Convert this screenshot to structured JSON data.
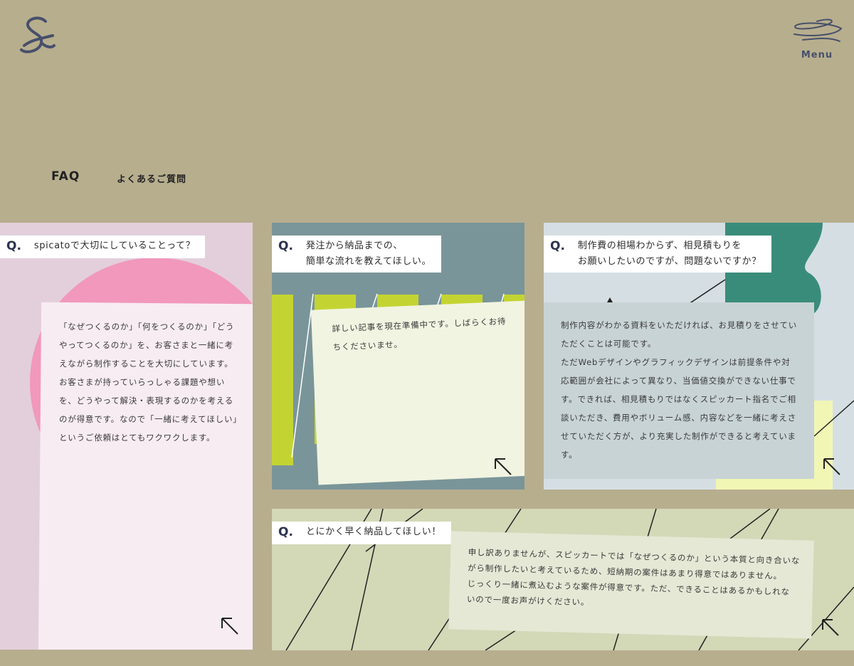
{
  "header": {
    "logo_icon": "script-s-signature-logo",
    "menu_icon": "scribble-menu-icon",
    "menu_label": "Menu"
  },
  "page": {
    "title_en": "FAQ",
    "title_ja": "よくあるご質問"
  },
  "colors": {
    "background": "#b7ae8e",
    "card1_bg": "#e3cfdb",
    "card1_circle": "#f198bc",
    "card1_note": "#f7ecf2",
    "card2_bg": "#7a9599",
    "card2_accent": "#c3d432",
    "card2_note": "#f1f4e1",
    "card3_bg": "#d5dfe3",
    "card3_accent": "#3a8c7a",
    "card3_yellow": "#f1f6b5",
    "card3_note": "#c8d3d6",
    "card4_bg": "#d3d8b7",
    "card4_note": "#e5e8d5",
    "q_mark": "#2b3350"
  },
  "faqs": [
    {
      "q_mark": "Q.",
      "question": "spicatoで大切にしていることって？",
      "answer": "「なぜつくるのか」「何をつくるのか」「どう\nやってつくるのか」を、お客さまと一緒に考\nえながら制作することを大切にしています。\nお客さまが持っていらっしゃる課題や想い\nを、どうやって解決・表現するのかを考える\nのが得意です。なので「一緒に考えてほしい」\nというご依頼はとてもワクワクします。",
      "arrow_icon": "arrow-up-left-icon"
    },
    {
      "q_mark": "Q.",
      "question": "発注から納品までの、\n簡単な流れを教えてほしい。",
      "answer": "詳しい記事を現在準備中です。しばらくお待\nちくださいませ。",
      "arrow_icon": "arrow-up-left-icon"
    },
    {
      "q_mark": "Q.",
      "question": "制作費の相場わからず、相見積もりを\nお願いしたいのですが、問題ないですか？",
      "answer": "制作内容がわかる資料をいただければ、お見積りをさせてい\nただくことは可能です。\nただWebデザインやグラフィックデザインは前提条件や対\n応範囲が会社によって異なり、当価値交換ができない仕事で\nす。できれば、相見積もりではなくスピッカート指名でご相\n談いただき、費用やボリューム感、内容などを一緒に考えさ\nせていただく方が、より充実した制作ができると考えていま\nす。",
      "arrow_icon": "arrow-up-left-icon"
    },
    {
      "q_mark": "Q.",
      "question": "とにかく早く納品してほしい！",
      "answer": "申し訳ありませんが、スピッカートでは「なぜつくるのか」という本質と向き合いな\nがら制作したいと考えているため、短納期の案件はあまり得意ではありません。\nじっくり一緒に煮込むような案件が得意です。ただ、できることはあるかもしれな\nいので一度お声がけください。",
      "arrow_icon": "arrow-up-left-icon"
    }
  ]
}
